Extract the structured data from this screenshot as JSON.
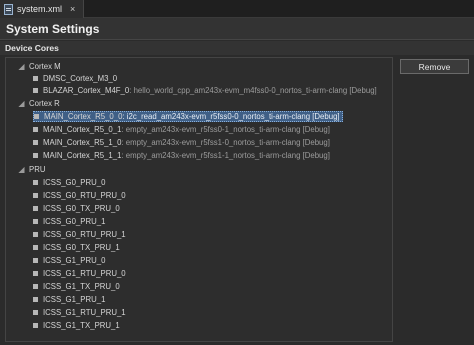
{
  "tab": {
    "label": "system.xml",
    "close": "×"
  },
  "header": {
    "title": "System Settings"
  },
  "section": {
    "title": "Device Cores"
  },
  "remove_label": "Remove",
  "groups": [
    {
      "label": "Cortex M"
    },
    {
      "label": "Cortex R"
    },
    {
      "label": "PRU"
    }
  ],
  "items": [
    {
      "name": "DMSC_Cortex_M3_0",
      "detail": ""
    },
    {
      "name": "BLAZAR_Cortex_M4F_0",
      "detail": " : hello_world_cpp_am243x-evm_m4fss0-0_nortos_ti-arm-clang [Debug]"
    },
    {
      "name": "MAIN_Cortex_R5_0_0",
      "detail": " : i2c_read_am243x-evm_r5fss0-0_nortos_ti-arm-clang [Debug]"
    },
    {
      "name": "MAIN_Cortex_R5_0_1",
      "detail": " : empty_am243x-evm_r5fss0-1_nortos_ti-arm-clang [Debug]"
    },
    {
      "name": "MAIN_Cortex_R5_1_0",
      "detail": " : empty_am243x-evm_r5fss1-0_nortos_ti-arm-clang [Debug]"
    },
    {
      "name": "MAIN_Cortex_R5_1_1",
      "detail": " : empty_am243x-evm_r5fss1-1_nortos_ti-arm-clang [Debug]"
    },
    {
      "name": "ICSS_G0_PRU_0",
      "detail": ""
    },
    {
      "name": "ICSS_G0_RTU_PRU_0",
      "detail": ""
    },
    {
      "name": "ICSS_G0_TX_PRU_0",
      "detail": ""
    },
    {
      "name": "ICSS_G0_PRU_1",
      "detail": ""
    },
    {
      "name": "ICSS_G0_RTU_PRU_1",
      "detail": ""
    },
    {
      "name": "ICSS_G0_TX_PRU_1",
      "detail": ""
    },
    {
      "name": "ICSS_G1_PRU_0",
      "detail": ""
    },
    {
      "name": "ICSS_G1_RTU_PRU_0",
      "detail": ""
    },
    {
      "name": "ICSS_G1_TX_PRU_0",
      "detail": ""
    },
    {
      "name": "ICSS_G1_PRU_1",
      "detail": ""
    },
    {
      "name": "ICSS_G1_RTU_PRU_1",
      "detail": ""
    },
    {
      "name": "ICSS_G1_TX_PRU_1",
      "detail": ""
    }
  ]
}
